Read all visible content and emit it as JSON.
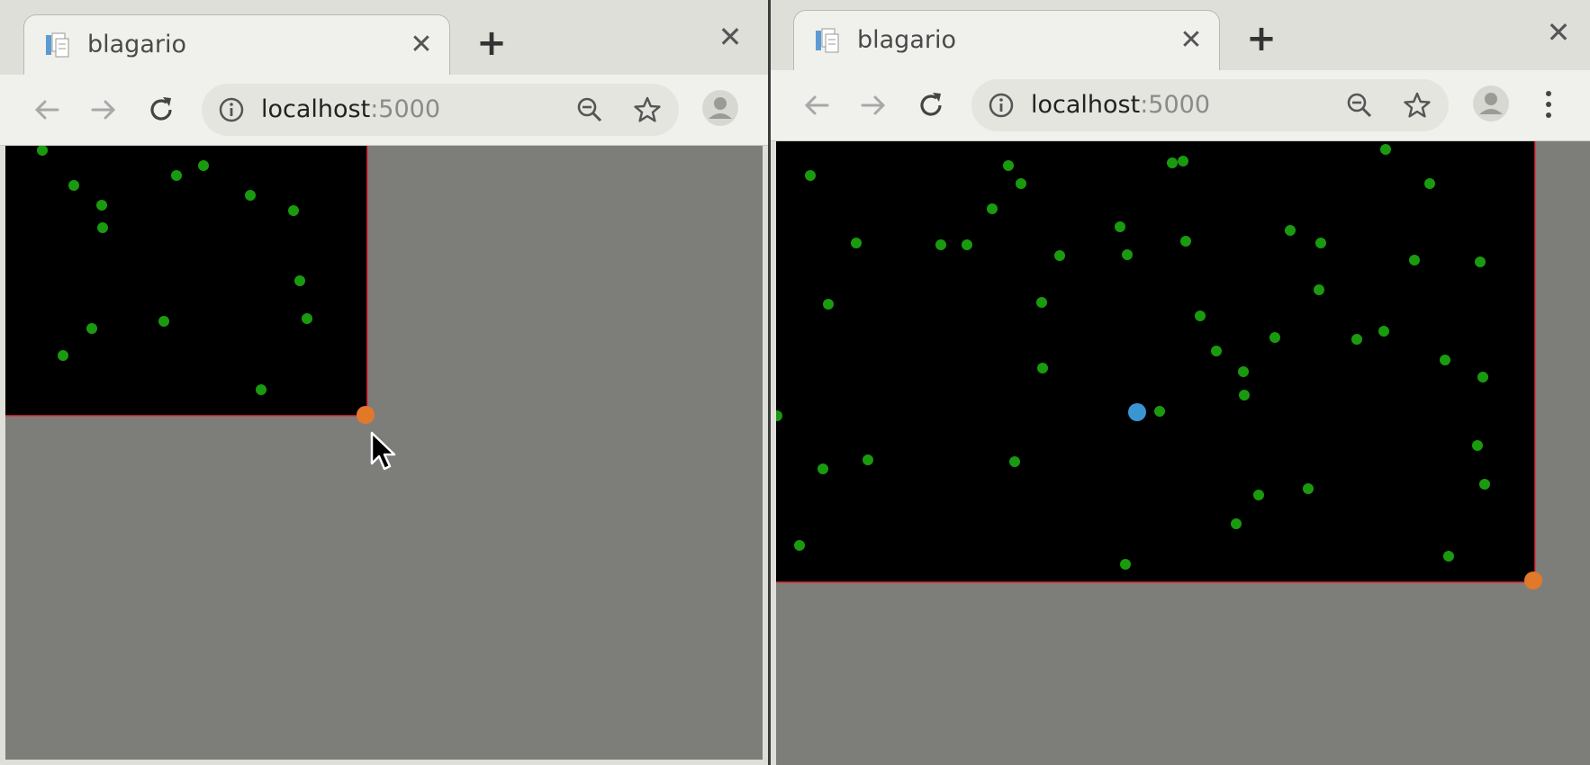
{
  "colors": {
    "viewport_bg": "#7d7e7a",
    "field_bg": "#000000",
    "field_border": "#e0303a",
    "food": "#1a9a0e",
    "corner_handle": "#e2782a",
    "player": "#3a96d2"
  },
  "icons": {
    "favicon": "document-stack-icon",
    "tab_close": "close-icon",
    "new_tab": "plus-icon",
    "window_close": "close-icon",
    "back": "arrow-left-icon",
    "forward": "arrow-right-icon",
    "reload": "reload-icon",
    "site_info": "info-circle-icon",
    "zoom": "zoom-out-icon",
    "bookmark": "star-icon",
    "profile": "avatar-icon",
    "menu": "kebab-menu-icon",
    "pointer": "mouse-cursor-icon"
  },
  "windows": [
    {
      "tab_title": "blagario",
      "url_host": "localhost",
      "url_port": ":5000",
      "tab_close_glyph": "✕",
      "new_tab_glyph": "+",
      "window_close_glyph": "✕"
    },
    {
      "tab_title": "blagario",
      "url_host": "localhost",
      "url_port": ":5000",
      "tab_close_glyph": "✕",
      "new_tab_glyph": "+",
      "window_close_glyph": "✕"
    }
  ]
}
